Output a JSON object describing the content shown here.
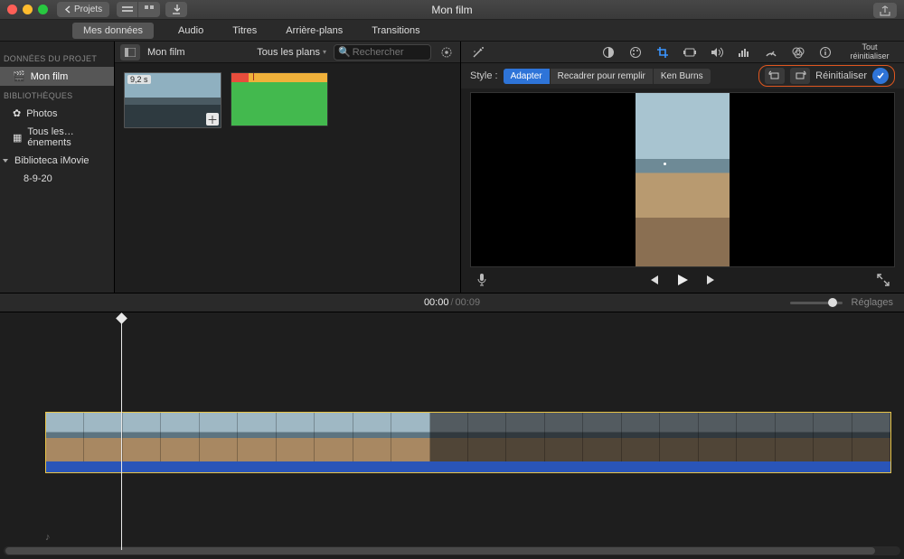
{
  "window": {
    "title": "Mon film",
    "back_label": "Projets"
  },
  "tabs": {
    "my_data": "Mes données",
    "audio": "Audio",
    "titles": "Titres",
    "backgrounds": "Arrière-plans",
    "transitions": "Transitions"
  },
  "sidebar": {
    "project_head": "DONNÉES DU PROJET",
    "project_name": "Mon film",
    "libraries_head": "BIBLIOTHÈQUES",
    "photos": "Photos",
    "all_events": "Tous les…énements",
    "imovie_lib": "Biblioteca iMovie",
    "event_date": "8-9-20"
  },
  "browser": {
    "title": "Mon film",
    "filter_label": "Tous les plans",
    "search_placeholder": "Rechercher",
    "clip_duration": "9,2 s"
  },
  "viewer": {
    "reset_all_label": "Tout\nréinitialiser",
    "style_label": "Style :",
    "style_fit": "Adapter",
    "style_crop": "Recadrer pour remplir",
    "style_kb": "Ken Burns",
    "reset_label": "Réinitialiser"
  },
  "timebar": {
    "current": "00:00",
    "total": "00:09",
    "settings": "Réglages"
  },
  "icons": {
    "wand": "magic-wand-icon",
    "contrast": "contrast-icon",
    "palette": "palette-icon",
    "crop": "crop-icon",
    "cam": "camera-icon",
    "vol": "volume-icon",
    "eq": "equalizer-icon",
    "speed": "speedometer-icon",
    "fx": "fx-icon",
    "info": "info-icon"
  }
}
